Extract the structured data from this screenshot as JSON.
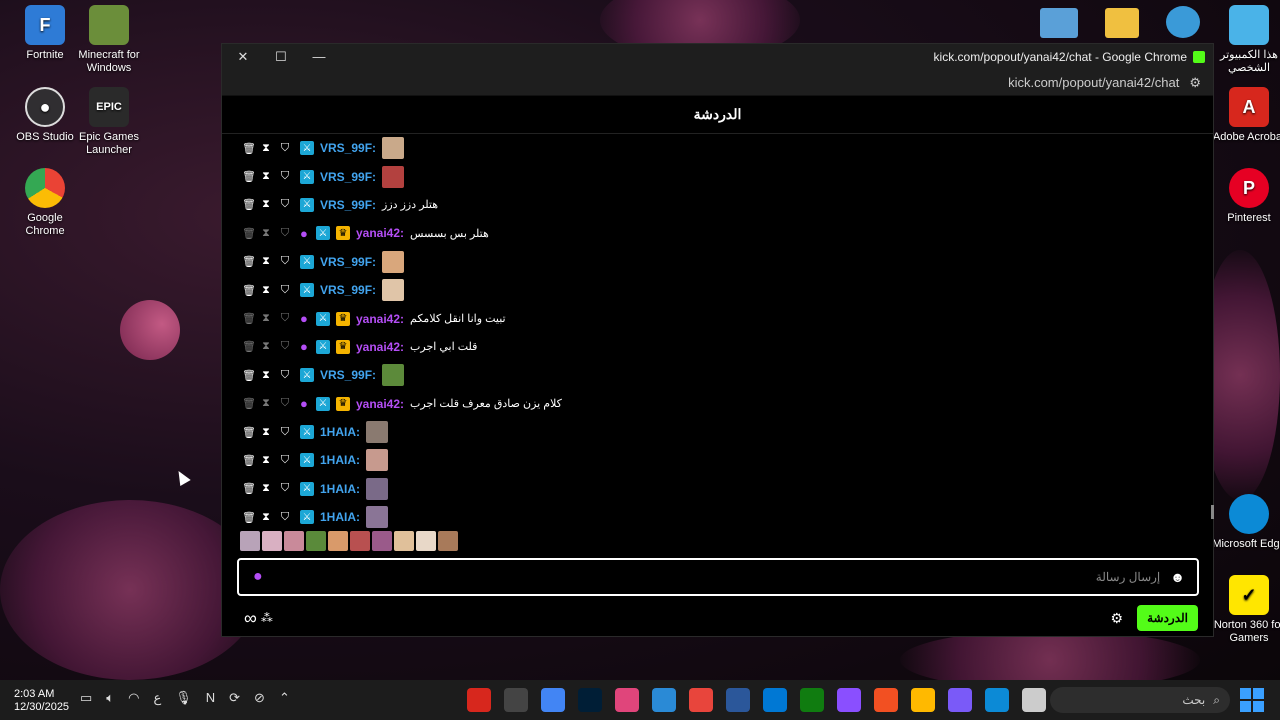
{
  "desktop": {
    "left_icons": [
      {
        "label": "Fortnite",
        "icon": "fortnite-icon",
        "color": "#2e7bd6"
      },
      {
        "label": "Minecraft for Windows",
        "icon": "minecraft-icon",
        "color": "#6b8e3a"
      },
      {
        "label": "OBS Studio",
        "icon": "obs-icon",
        "color": "#302e31"
      },
      {
        "label": "Epic Games Launcher",
        "icon": "epic-games-icon",
        "color": "#2a2a2a"
      },
      {
        "label": "Google Chrome",
        "icon": "chrome-icon",
        "color": "#4285f4"
      }
    ],
    "right_icons": [
      {
        "label": "هذا الكمبيوتر الشخصي",
        "icon": "this-pc-icon",
        "color": "#4ab3e8"
      },
      {
        "label": "Adobe Acrobat",
        "icon": "acrobat-icon",
        "color": "#d7271d"
      },
      {
        "label": "Pinterest",
        "icon": "pinterest-icon",
        "color": "#e60023"
      },
      {
        "label": "Microsoft Edge",
        "icon": "edge-icon",
        "color": "#0c8ad6"
      },
      {
        "label": "Norton 360 for Gamers",
        "icon": "norton-icon",
        "color": "#ffe600"
      }
    ]
  },
  "window": {
    "title": "kick.com/popout/yanai42/chat - Google Chrome",
    "url": "kick.com/popout/yanai42/chat",
    "controls": {
      "close": "✕",
      "maximize": "☐",
      "minimize": "—"
    }
  },
  "chat": {
    "header": "الدردشة",
    "messages": [
      {
        "user": "VRS_99F:",
        "role": "mod",
        "text": "",
        "emote": "#c9a98a"
      },
      {
        "user": "VRS_99F:",
        "role": "mod",
        "text": "",
        "emote": "#b3413f"
      },
      {
        "user": "VRS_99F:",
        "role": "mod",
        "text": "هتلر دزز دزز",
        "emote": ""
      },
      {
        "user": "yanai42:",
        "role": "owner",
        "text": "هتلر بس بسسس",
        "emote": ""
      },
      {
        "user": "VRS_99F:",
        "role": "mod",
        "text": "",
        "emote": "#d9a77c"
      },
      {
        "user": "VRS_99F:",
        "role": "mod",
        "text": "",
        "emote": "#e0c5a8"
      },
      {
        "user": "yanai42:",
        "role": "owner",
        "text": "تبيت وانا انقل كلامكم",
        "emote": ""
      },
      {
        "user": "yanai42:",
        "role": "owner",
        "text": "قلت ابي اجرب",
        "emote": ""
      },
      {
        "user": "VRS_99F:",
        "role": "mod",
        "text": "",
        "emote": "#5c8a3a"
      },
      {
        "user": "yanai42:",
        "role": "owner",
        "text": "كلام يزن صادق معرف قلت اجرب",
        "emote": ""
      },
      {
        "user": "1HAIA:",
        "role": "mod",
        "text": "",
        "emote": "#8a7a70"
      },
      {
        "user": "1HAIA:",
        "role": "mod",
        "text": "",
        "emote": "#c79a8e"
      },
      {
        "user": "1HAIA:",
        "role": "mod",
        "text": "",
        "emote": "#7a6a88"
      },
      {
        "user": "1HAIA:",
        "role": "mod",
        "text": "",
        "emote": "#8a7596"
      }
    ],
    "emote_bar": [
      "#b8a3b8",
      "#d9b0c2",
      "#c98a9a",
      "#5a8a3a",
      "#d99a6a",
      "#b85050",
      "#9a5a8a",
      "#e0c09a",
      "#e8d8c8",
      "#a87a5a"
    ],
    "input_placeholder": "إرسال رسالة",
    "send_label": "الدردشة",
    "colors": {
      "accent": "#53fc18",
      "mod_name": "#42a4ee",
      "owner_name": "#b44ef5"
    }
  },
  "taskbar": {
    "time": "2:03 AM",
    "date": "12/30/2025",
    "search_label": "بحث",
    "apps": [
      "#d7271d",
      "#444444",
      "#4285f4",
      "#001e36",
      "#e0457b",
      "#2a8ad6",
      "#e8453c",
      "#2b579a",
      "#0078d4",
      "#107c10",
      "#8a4fff",
      "#f25022",
      "#ffb900",
      "#7a5af8",
      "#0c8ad6",
      "#cccccc"
    ],
    "lang": "ع"
  }
}
